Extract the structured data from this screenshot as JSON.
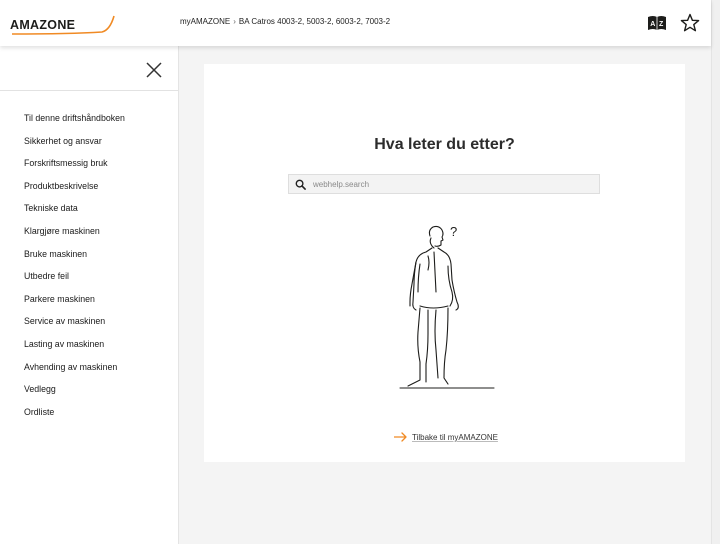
{
  "header": {
    "logo_text": "AMAZONE",
    "breadcrumb": [
      "myAMAZONE",
      "BA Catros 4003-2, 5003-2, 6003-2, 7003-2"
    ],
    "breadcrumb_separator": "›",
    "language_icon": "dictionary-a-z-icon",
    "favorite_icon": "star-outline-icon"
  },
  "sidebar": {
    "close_icon": "close-icon",
    "items": [
      {
        "label": "Til denne driftshåndboken"
      },
      {
        "label": "Sikkerhet og ansvar"
      },
      {
        "label": "Forskriftsmessig bruk"
      },
      {
        "label": "Produktbeskrivelse"
      },
      {
        "label": "Tekniske data"
      },
      {
        "label": "Klargjøre maskinen"
      },
      {
        "label": "Bruke maskinen"
      },
      {
        "label": "Utbedre feil"
      },
      {
        "label": "Parkere maskinen"
      },
      {
        "label": "Service av maskinen"
      },
      {
        "label": "Lasting av maskinen"
      },
      {
        "label": "Avhending av maskinen"
      },
      {
        "label": "Vedlegg"
      },
      {
        "label": "Ordliste"
      }
    ]
  },
  "main": {
    "heading": "Hva leter du etter?",
    "search": {
      "placeholder": "webhelp.search",
      "value": ""
    },
    "illustration_text": "?",
    "back_link": "Tilbake til myAMAZONE"
  },
  "colors": {
    "accent_orange": "#f08a24",
    "background_gray": "#f4f4f4",
    "text_dark": "#222222"
  }
}
